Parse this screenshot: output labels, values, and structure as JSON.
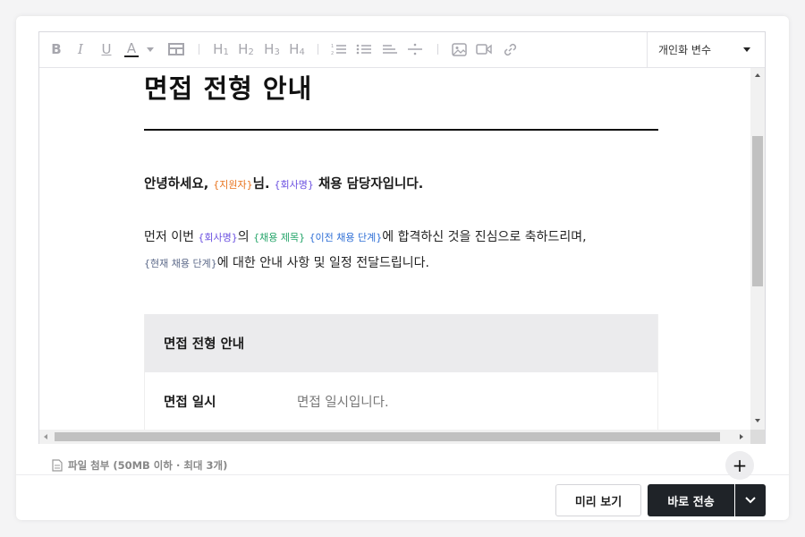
{
  "toolbar": {
    "bold_label": "B",
    "italic_label": "I",
    "underline_label": "U",
    "text_color_label": "A",
    "h1_label": "H",
    "h1_sub": "1",
    "h2_label": "H",
    "h2_sub": "2",
    "h3_label": "H",
    "h3_sub": "3",
    "h4_label": "H",
    "h4_sub": "4",
    "variable_select_label": "개인화 변수"
  },
  "document": {
    "title": "면접 전형 안내",
    "greeting_prefix": "안녕하세요, ",
    "var_applicant": "{지원자}",
    "greeting_mid": "님. ",
    "var_company": "{회사명}",
    "greeting_suffix": " 채용 담당자입니다.",
    "para_line1_prefix": "먼저 이번 ",
    "para_var_company": "{회사명}",
    "para_line1_a": "의 ",
    "para_var_job_title": "{채용 제목}",
    "para_line1_b": " ",
    "para_var_prev_stage": "{이전 채용 단계}",
    "para_line1_suffix": "에 합격하신 것을 진심으로 축하드리며,",
    "para_var_current_stage": "{현재 채용 단계}",
    "para_line2_suffix": "에 대한 안내 사항 및 일정 전달드립니다.",
    "table": {
      "header": "면접 전형 안내",
      "rows": [
        {
          "key": "면접 일시",
          "value": "면접 일시입니다."
        }
      ]
    }
  },
  "footer": {
    "attach_label": "파일 첨부 (50MB 이하 · 최대 3개)",
    "add_label": "+",
    "preview_label": "미리 보기",
    "send_label": "바로 전송"
  },
  "colors": {
    "var_applicant": "#e8721c",
    "var_company": "#6a4fe0",
    "var_job_title": "#25a56a",
    "var_prev_stage": "#2f6fd6",
    "var_current_stage": "#5d6a8a",
    "primary_button": "#1f2328"
  },
  "icons": [
    "bold-icon",
    "italic-icon",
    "underline-icon",
    "text-color-icon",
    "table-icon",
    "ordered-list-icon",
    "bullet-list-icon",
    "align-icon",
    "divider-icon",
    "image-icon",
    "video-icon",
    "link-icon",
    "file-icon",
    "chevron-down-icon"
  ]
}
